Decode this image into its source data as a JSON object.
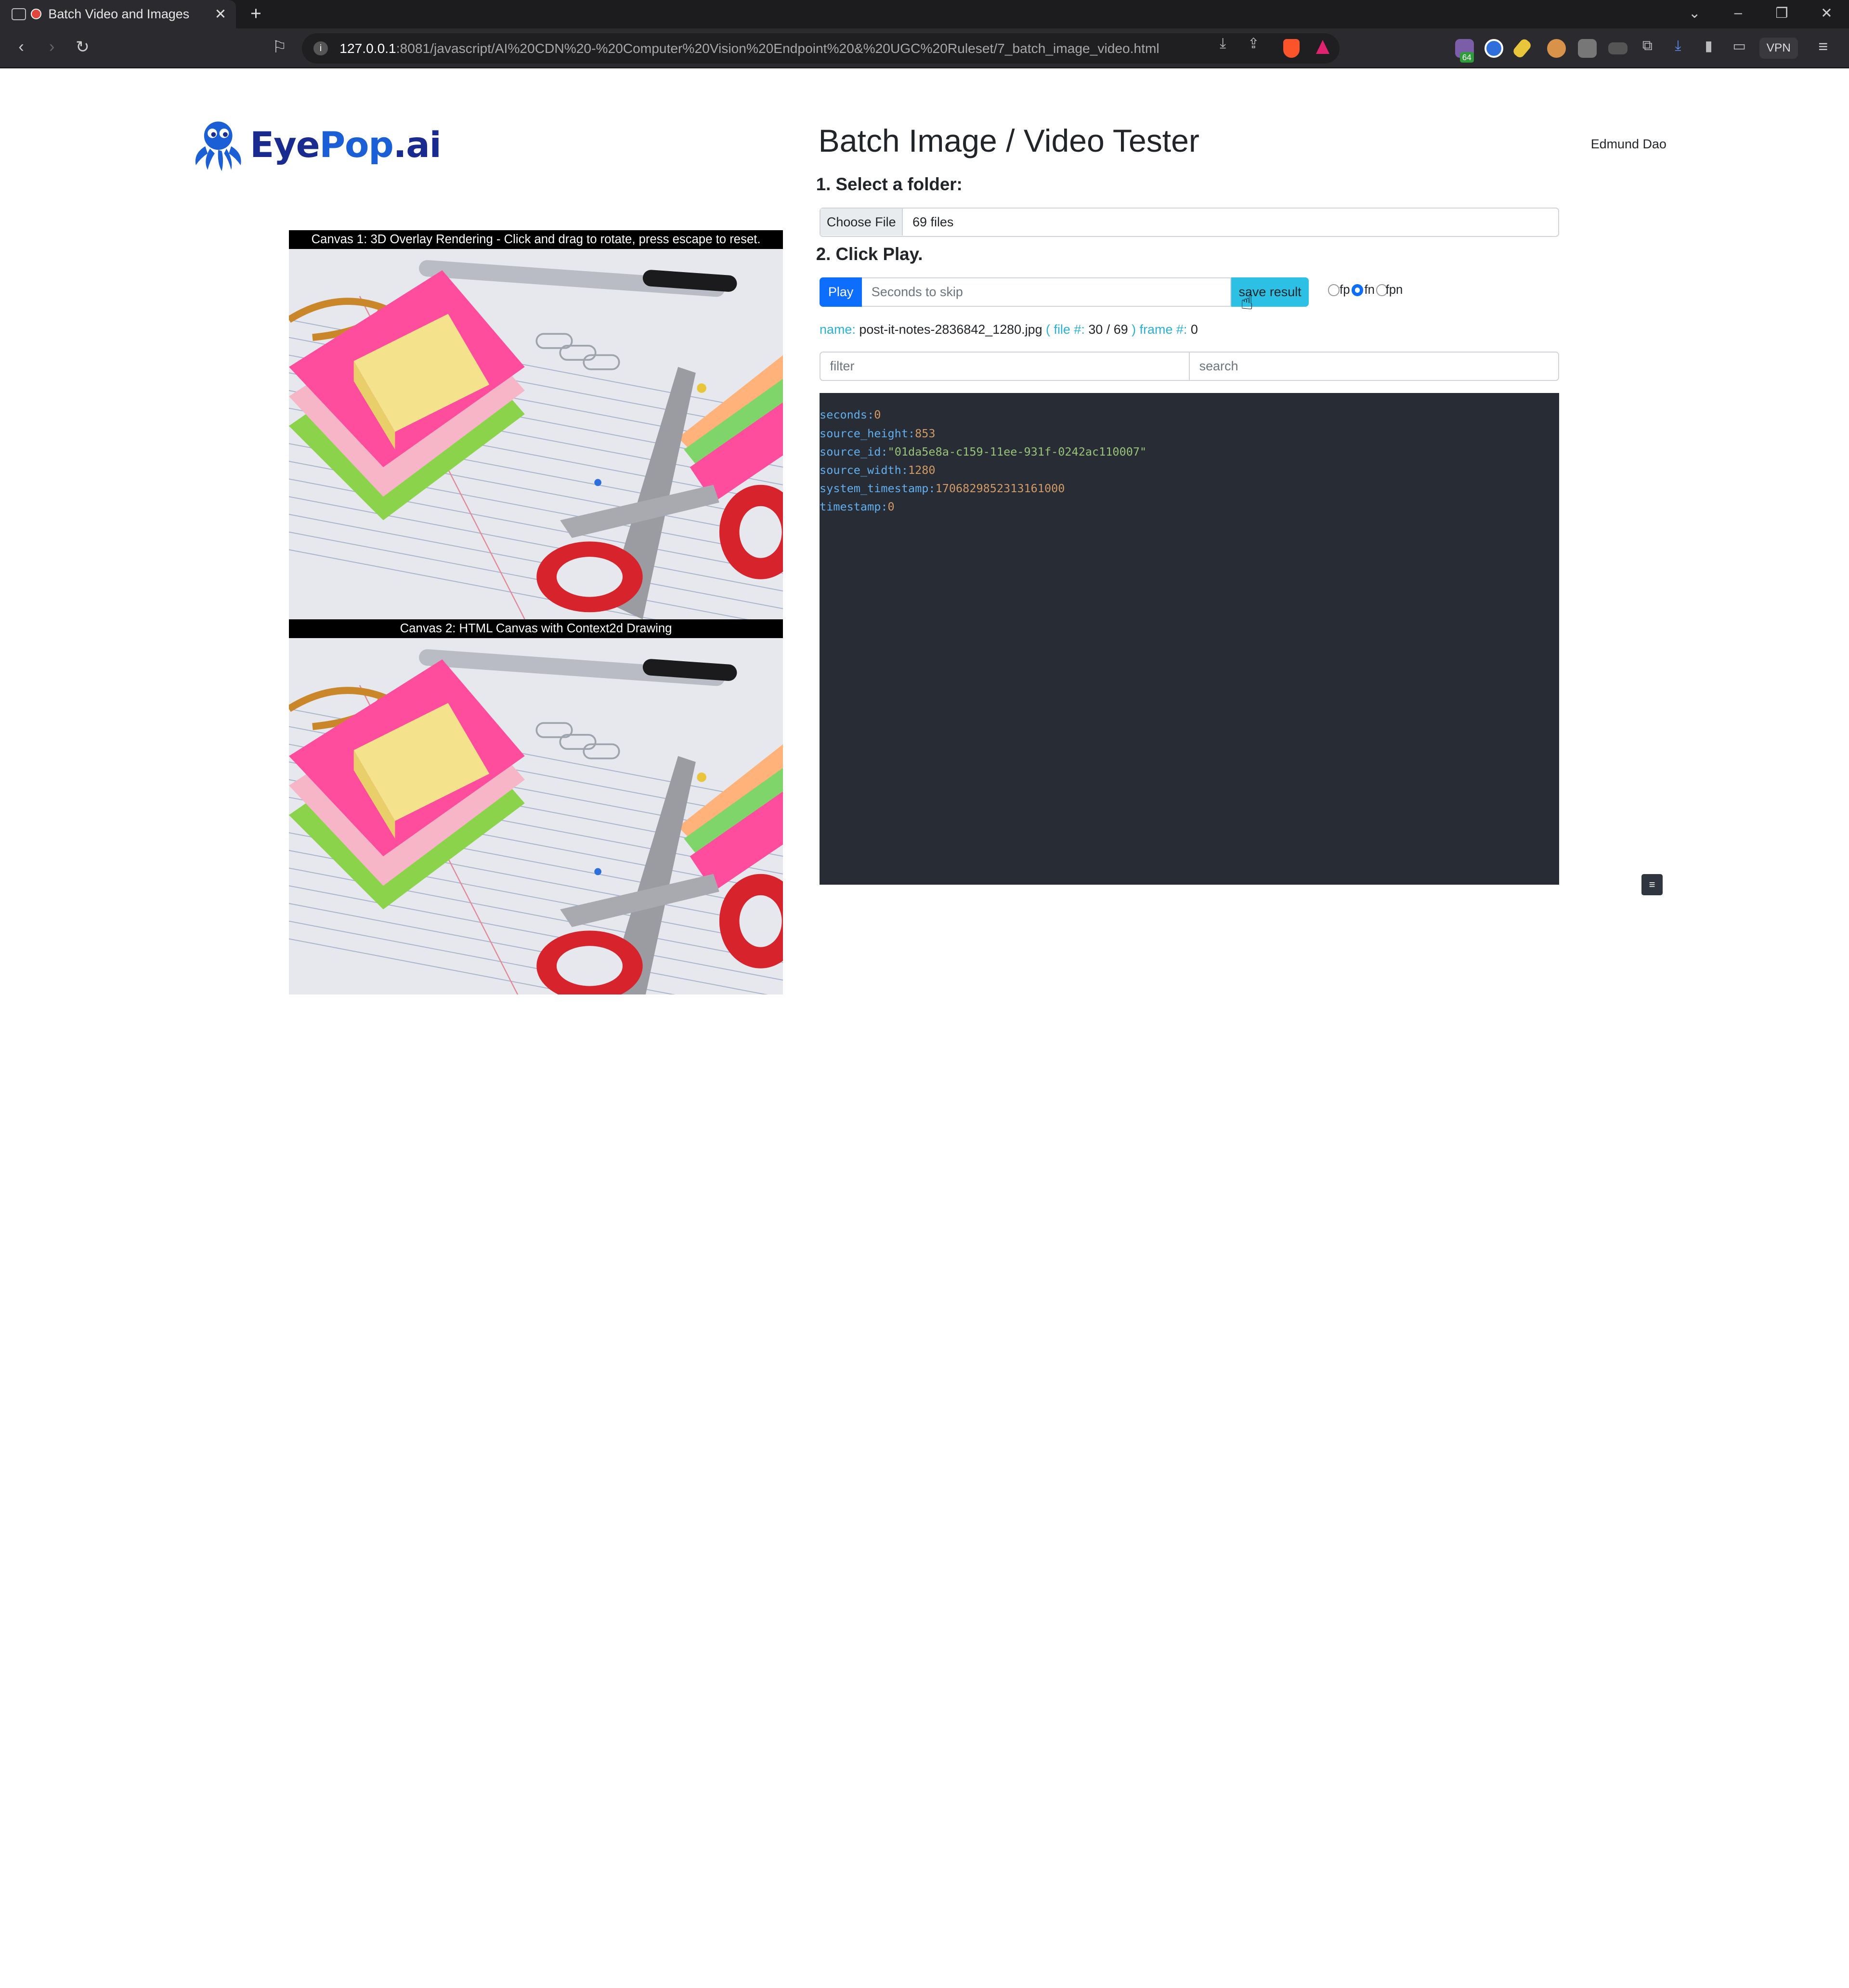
{
  "browser": {
    "tab_title": "Batch Video and Images",
    "url_host": "127.0.0.1",
    "url_rest": ":8081/javascript/AI%20CDN%20-%20Computer%20Vision%20Endpoint%20&%20UGC%20Ruleset/7_batch_image_video.html",
    "ext_badge": "64",
    "vpn_label": "VPN"
  },
  "logo": {
    "part1": "Eye",
    "part2": "Pop",
    "part3": ".ai"
  },
  "page": {
    "title": "Batch Image / Video Tester",
    "user": "Edmund Dao",
    "step1": "1. Select a folder:",
    "step2": "2. Click Play."
  },
  "file_input": {
    "button": "Choose File",
    "value": "69 files"
  },
  "controls": {
    "play": "Play",
    "skip_placeholder": "Seconds to skip",
    "save": "save result",
    "radios": [
      {
        "label": "fp",
        "checked": false
      },
      {
        "label": "fn",
        "checked": true
      },
      {
        "label": "fpn",
        "checked": false
      }
    ]
  },
  "status": {
    "name_key": "name:",
    "name_value": "post-it-notes-2836842_1280.jpg",
    "file_key_open": "( file #:",
    "file_value": "30 / 69",
    "file_key_close": ")",
    "frame_key": "frame #:",
    "frame_value": "0"
  },
  "filters": {
    "filter_placeholder": "filter",
    "search_placeholder": "search"
  },
  "canvases": [
    {
      "caption": "Canvas 1: 3D Overlay Rendering - Click and drag to rotate, press escape to reset."
    },
    {
      "caption": "Canvas 2: HTML Canvas with Context2d Drawing"
    }
  ],
  "json_output": [
    {
      "key": "seconds",
      "value": "0",
      "type": "num"
    },
    {
      "key": "source_height",
      "value": "853",
      "type": "num"
    },
    {
      "key": "source_id",
      "value": "\"01da5e8a-c159-11ee-931f-0242ac110007\"",
      "type": "str"
    },
    {
      "key": "source_width",
      "value": "1280",
      "type": "num"
    },
    {
      "key": "system_timestamp",
      "value": "1706829852313161000",
      "type": "num"
    },
    {
      "key": "timestamp",
      "value": "0",
      "type": "num"
    }
  ],
  "colors": {
    "primary": "#0d6efd",
    "info": "#2bc0e4",
    "panel_bg": "#282c34"
  }
}
